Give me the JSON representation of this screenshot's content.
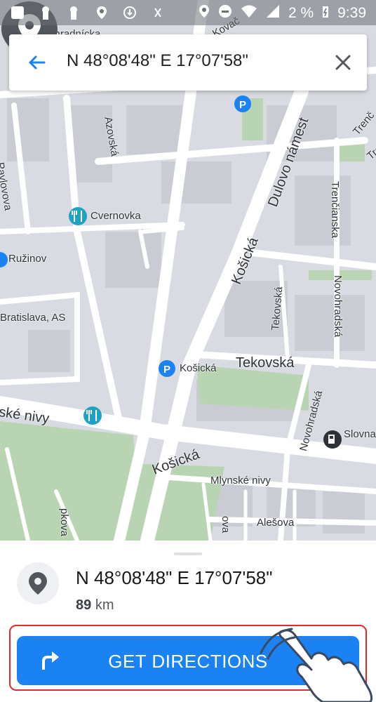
{
  "status_bar": {
    "battery": "2 %",
    "time": "9:39"
  },
  "search": {
    "query": "N 48°08'48\" E 17°07'58\""
  },
  "map_labels": {
    "zahradnicka": "Záhradnícka",
    "pavlovova": "Pavlovova",
    "azovska": "Azovská",
    "cervnovka": "Cvernovka",
    "ruzinov": "Ružinov",
    "bratislava_as": "Bratislava, AS",
    "kosicka_1": "Košická",
    "kosicka_poi": "Košická",
    "kosicka_2": "Košická",
    "dulovo": "Dulovo námest",
    "trencianska_1": "Trenč",
    "trencianska_2": "Trenčianska",
    "trencianska_3": "Trenčianska",
    "tekovska_1": "Tekovská",
    "tekovska_2": "Tekovská",
    "novohradska_1": "Novohradská",
    "novohradska_2": "Novohradská",
    "ske_nivy": "ské nivy",
    "slovna": "Slovna",
    "mlynske_nivy": "Mlynské nivy",
    "alesova": "Alešova",
    "kovacska": "Kovač",
    "misc_a": "a",
    "misc_b": "ova",
    "misc_c": "pkova"
  },
  "place": {
    "title": "N 48°08'48\" E 17°07'58\"",
    "distance_value": "89",
    "distance_unit": "km"
  },
  "actions": {
    "directions_label": "GET DIRECTIONS"
  }
}
